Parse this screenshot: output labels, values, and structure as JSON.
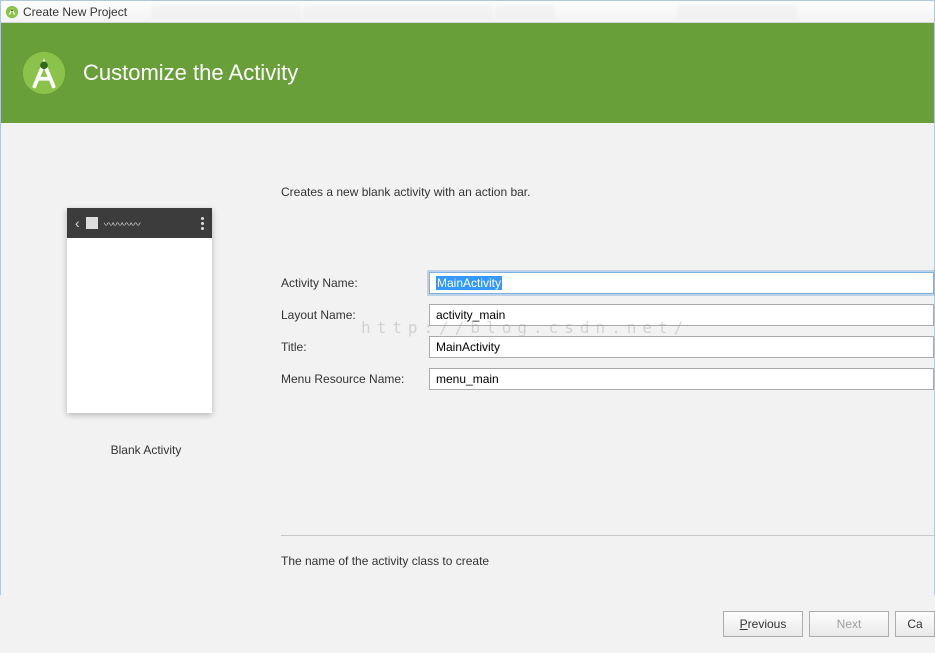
{
  "window": {
    "title": "Create New Project"
  },
  "header": {
    "title": "Customize the Activity"
  },
  "description": "Creates a new blank activity with an action bar.",
  "preview": {
    "label": "Blank Activity"
  },
  "form": {
    "activity_name": {
      "label": "Activity Name:",
      "value": "MainActivity"
    },
    "layout_name": {
      "label": "Layout Name:",
      "value": "activity_main"
    },
    "title": {
      "label": "Title:",
      "value": "MainActivity"
    },
    "menu_resource": {
      "label": "Menu Resource Name:",
      "value": "menu_main"
    }
  },
  "hint": "The name of the activity class to create",
  "buttons": {
    "previous": "Previous",
    "next": "Next",
    "cancel": "Cancel"
  },
  "watermark": "http://blog.csdn.net/"
}
